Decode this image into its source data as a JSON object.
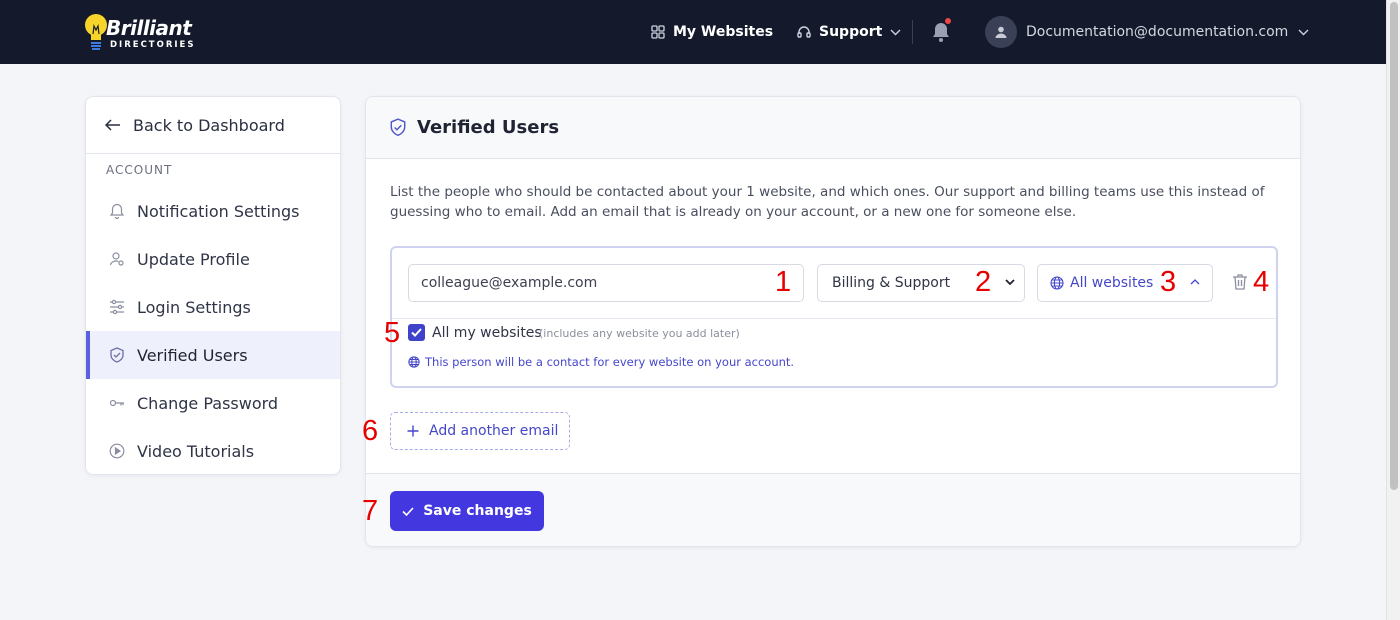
{
  "topbar": {
    "logo_top": "Brilliant",
    "logo_bottom": "DIRECTORIES",
    "my_websites": "My Websites",
    "support": "Support",
    "account_email": "Documentation@documentation.com",
    "notification_dot_color": "#ef4444"
  },
  "sidebar": {
    "back": "Back to Dashboard",
    "section": "ACCOUNT",
    "items": [
      {
        "label": "Notification Settings",
        "icon": "bell-icon"
      },
      {
        "label": "Update Profile",
        "icon": "user-icon"
      },
      {
        "label": "Login Settings",
        "icon": "sliders-icon"
      },
      {
        "label": "Verified Users",
        "icon": "shield-check-icon",
        "active": true
      },
      {
        "label": "Change Password",
        "icon": "key-icon"
      },
      {
        "label": "Video Tutorials",
        "icon": "play-circle-icon"
      }
    ]
  },
  "main": {
    "title": "Verified Users",
    "description": "List the people who should be contacted about your 1 website, and which ones. Our support and billing teams use this instead of guessing who to email. Add an email that is already on your account, or a new one for someone else.",
    "entry": {
      "email_value": "colleague@example.com",
      "role_value": "Billing & Support",
      "sites_label": "All websites",
      "checkbox_label": "All my websites",
      "checkbox_hint": "(includes any website you add later)",
      "checkbox_checked": true,
      "info_text": "This person will be a contact for every website on your account."
    },
    "add_another": "Add another email",
    "save": "Save changes"
  },
  "markers": [
    "1",
    "2",
    "3",
    "4",
    "5",
    "6",
    "7"
  ],
  "colors": {
    "topbar_bg": "#141a2b",
    "accent": "#4338e0",
    "link": "#4547c9",
    "marker": "#e60000"
  }
}
